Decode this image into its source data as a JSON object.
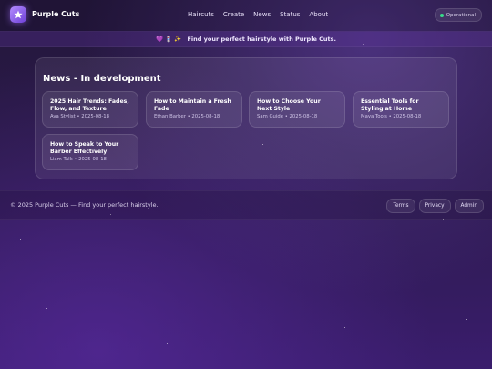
{
  "header": {
    "brand": "Purple Cuts",
    "nav": [
      "Haircuts",
      "Create",
      "News",
      "Status",
      "About"
    ],
    "status_label": "Operational"
  },
  "banner": {
    "emoji": "💜 💈 ✨",
    "text": "Find your perfect hairstyle with Purple Cuts."
  },
  "news": {
    "title": "News - In development",
    "cards": [
      {
        "title": "2025 Hair Trends: Fades, Flow, and Texture",
        "meta": "Ava Stylist • 2025-08-18"
      },
      {
        "title": "How to Maintain a Fresh Fade",
        "meta": "Ethan Barber • 2025-08-18"
      },
      {
        "title": "How to Choose Your Next Style",
        "meta": "Sam Guide • 2025-08-18"
      },
      {
        "title": "Essential Tools for Styling at Home",
        "meta": "Maya Tools • 2025-08-18"
      },
      {
        "title": "How to Speak to Your Barber Effectively",
        "meta": "Liam Talk • 2025-08-18"
      }
    ]
  },
  "footer": {
    "copyright": "© 2025 Purple Cuts — Find your perfect hairstyle.",
    "links": [
      "Terms",
      "Privacy",
      "Admin"
    ]
  },
  "colors": {
    "accent": "#8b5cf6",
    "status_ok": "#38d98a"
  }
}
